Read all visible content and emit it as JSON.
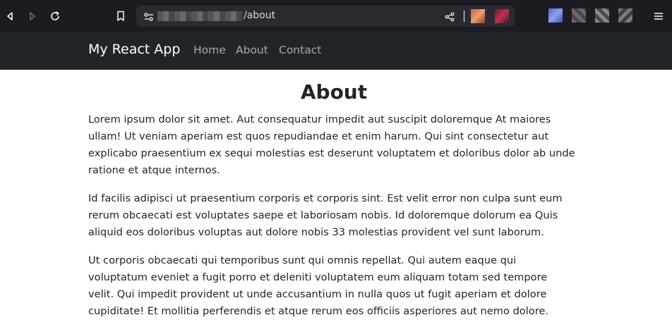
{
  "browser": {
    "url_path": "/about"
  },
  "navbar": {
    "brand": "My React App",
    "links": [
      "Home",
      "About",
      "Contact"
    ]
  },
  "page": {
    "title": "About",
    "paragraphs": [
      "Lorem ipsum dolor sit amet. Aut consequatur impedit aut suscipit doloremque At maiores ullam! Ut veniam aperiam est quos repudiandae et enim harum. Qui sint consectetur aut explicabo praesentium ex sequi molestias est deserunt voluptatem et doloribus dolor ab unde ratione et atque internos.",
      "Id facilis adipisci ut praesentium corporis et corporis sint. Est velit error non culpa sunt eum rerum obcaecati est voluptates saepe et laboriosam nobis. Id doloremque dolorum ea Quis aliquid eos doloribus voluptas aut dolore nobis 33 molestias provident vel sunt laborum.",
      "Ut corporis obcaecati qui temporibus sunt qui omnis repellat. Qui autem eaque qui voluptatum eveniet a fugit porro et deleniti voluptatem eum aliquam totam sed tempore velit. Qui impedit provident ut unde accusantium in nulla quos ut fugit aperiam et dolore cupiditate! Et mollitia perferendis et atque rerum eos officiis asperiores aut nemo dolore."
    ]
  },
  "icons": {
    "back": "back-arrow-icon",
    "forward": "forward-arrow-icon",
    "reload": "reload-icon",
    "bookmark": "bookmark-icon",
    "site_info": "site-settings-icon",
    "share": "share-icon",
    "menu": "hamburger-menu-icon"
  },
  "colors": {
    "browser_bg": "#1c1b22",
    "urlbar_bg": "#2b2a33",
    "navbar_bg": "#212529",
    "text": "#212529"
  }
}
